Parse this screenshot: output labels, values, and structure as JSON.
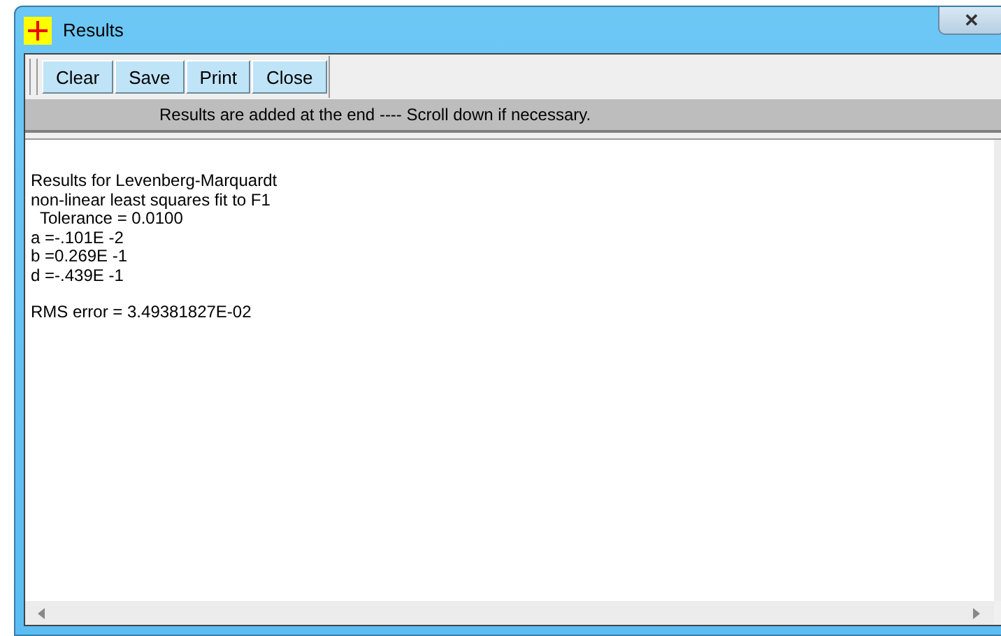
{
  "window": {
    "title": "Results",
    "close": "✕"
  },
  "toolbar": {
    "buttons": [
      "Clear",
      "Save",
      "Print",
      "Close"
    ]
  },
  "info_bar": "Results are added at the end ---- Scroll down if necessary.",
  "output": {
    "blocks": [
      [
        "Results for Levenberg-Marquardt",
        "non-linear least squares fit to F1",
        "  Tolerance = 0.0100",
        "a =-.101E -2",
        "b =0.269E -1",
        "d =-.439E -1"
      ],
      [
        "RMS error = 3.49381827E-02"
      ]
    ]
  }
}
